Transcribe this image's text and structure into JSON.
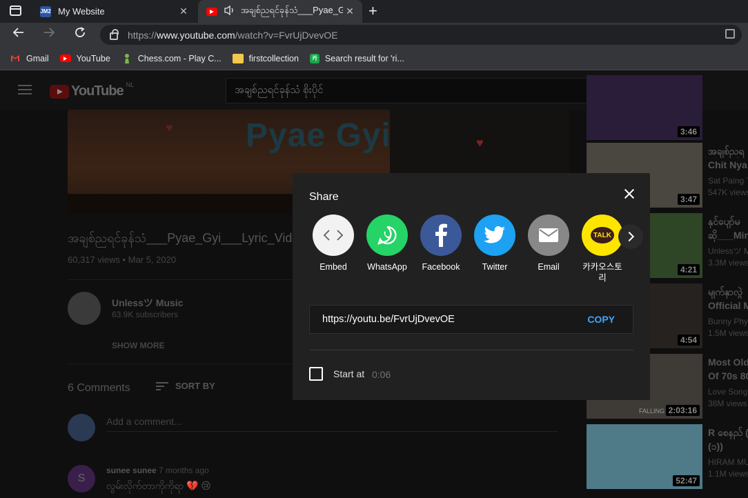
{
  "browser": {
    "tabs": [
      {
        "title": "My Website",
        "favicon_text": "JM2",
        "active": false
      },
      {
        "title": "အချစ်ညရင်ခုန်သံ___Pyae_Gyi",
        "active": true
      }
    ],
    "url": {
      "scheme": "https://",
      "host": "www.youtube.com",
      "path": "/watch?v=FvrUjDvevOE"
    },
    "bookmarks": [
      {
        "label": "Gmail",
        "icon": "gmail-icon"
      },
      {
        "label": "YouTube",
        "icon": "youtube-icon"
      },
      {
        "label": "Chess.com - Play C...",
        "icon": "chess-pawn-icon"
      },
      {
        "label": "firstcollection",
        "icon": "folder-icon"
      },
      {
        "label": "Search result for 'ri...",
        "icon": "kakao-ka-icon",
        "icon_text": "카"
      }
    ]
  },
  "youtube": {
    "logo_text": "YouTube",
    "country_code": "NL",
    "search_value": "အချစ်ညရင်ခုန်သံ စိုးပိုင်",
    "video": {
      "thumb_text": "Pyae Gyi",
      "title": "အချစ်ညရင်ခုန်သံ___Pyae_Gyi___Lyric_Video",
      "views": "60,317 views",
      "date": "Mar 5, 2020",
      "meta_sep": " • "
    },
    "channel": {
      "name": "Unlessツ Music",
      "subs": "63.9K subscribers",
      "show_more": "SHOW MORE"
    },
    "comments": {
      "count": "6 Comments",
      "sort_by": "SORT BY",
      "add_placeholder": "Add a comment...",
      "first": {
        "avatar_letter": "S",
        "author": "sunee sunee",
        "time": "7 months ago",
        "text": "လွမ်းလိုက်တာကိုကိုရာ 💔 😢"
      }
    },
    "sidebar": [
      {
        "duration": "3:46",
        "title": "",
        "channel": "",
        "views": "",
        "thumb_color": "#2a1d3a"
      },
      {
        "duration": "3:47",
        "title": "အချစ်ညရ",
        "title2": "Chit Nya",
        "channel": "Sat Paing T",
        "views": "547K views",
        "thumb_color": "#5c5750"
      },
      {
        "duration": "4:21",
        "title": "နှင်ပျော်မ",
        "title2": "ဆို___Min_",
        "channel": "Unlessツ M",
        "views": "3.3M views",
        "thumb_color": "#3d5a32"
      },
      {
        "duration": "4:54",
        "title": "မျက်နှာလွဲ",
        "title2": "Official M",
        "channel": "Bunny Phy",
        "views": "1.5M views",
        "thumb_color": "#2f2a28"
      },
      {
        "duration": "2:03:16",
        "title": "Most Old",
        "title2": "Of 70s 80",
        "channel": "Love Songs",
        "views": "38M views",
        "thumb_color": "#5a5650",
        "thumb_text": "FALLING"
      },
      {
        "duration": "52:47",
        "title": "R စေနည် (",
        "title2": "(၁))",
        "channel": "HIRAM MU",
        "views": "1.1M views",
        "thumb_color": "#6fa0b0"
      }
    ]
  },
  "share_dialog": {
    "title": "Share",
    "targets": [
      {
        "label": "Embed",
        "icon": "embed-code-icon"
      },
      {
        "label": "WhatsApp",
        "icon": "whatsapp-icon"
      },
      {
        "label": "Facebook",
        "icon": "facebook-icon"
      },
      {
        "label": "Twitter",
        "icon": "twitter-icon"
      },
      {
        "label": "Email",
        "icon": "email-icon"
      },
      {
        "label": "카카오스토리",
        "icon": "kakao-talk-icon",
        "icon_text": "TALK"
      }
    ],
    "link": "https://youtu.be/FvrUjDvevOE",
    "copy_label": "COPY",
    "start_at_label": "Start at",
    "start_at_time": "0:06",
    "start_at_checked": false
  }
}
